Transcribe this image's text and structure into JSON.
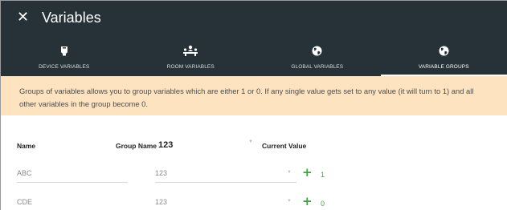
{
  "window": {
    "title": "Variables",
    "close_icon": "close-icon"
  },
  "tabs": [
    {
      "label": "DEVICE VARIABLES",
      "icon": "device-icon",
      "active": false
    },
    {
      "label": "ROOM VARIABLES",
      "icon": "room-icon",
      "active": false
    },
    {
      "label": "GLOBAL VARIABLES",
      "icon": "globe-icon",
      "active": false
    },
    {
      "label": "VARIABLE GROUPS",
      "icon": "globe-icon",
      "active": true
    }
  ],
  "notice": "Groups of variables allows you to group variables which are either 1 or 0. If any single value gets set to any value (it will turn to 1) and all other variables in the group become 0.",
  "table": {
    "headers": {
      "name": "Name",
      "group_name": "Group Name",
      "current_value": "Current Value"
    },
    "group_select_value": "123",
    "rows": [
      {
        "name": "ABC",
        "group": "123",
        "value": "1"
      },
      {
        "name": "CDE",
        "group": "123",
        "value": "0"
      }
    ]
  },
  "colors": {
    "header_bg": "#263238",
    "notice_bg": "#fde3bf",
    "accent_green": "#43a047"
  }
}
